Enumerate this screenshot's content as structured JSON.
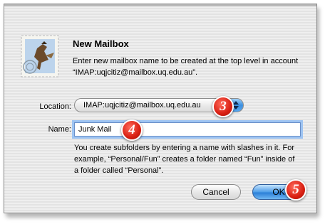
{
  "dialog": {
    "title": "New Mailbox",
    "message": "Enter new mailbox name to be created at the top level in account “IMAP:uqjcitiz@mailbox.uq.edu.au”.",
    "location_label": "Location:",
    "location_value": "IMAP:uqjcitiz@mailbox.uq.edu.au",
    "name_label": "Name:",
    "name_value": "Junk Mail",
    "help_text": "You create subfolders by entering a name with slashes in it. For example, “Personal/Fun” creates a folder named “Fun” inside of a folder called “Personal”.",
    "cancel_label": "Cancel",
    "ok_label": "OK"
  },
  "steps": {
    "three": "3",
    "four": "4",
    "five": "5"
  },
  "icons": {
    "app": "mail-stamp-icon",
    "popup": "up-down-arrows-icon"
  },
  "colors": {
    "accent": "#3b8fe0",
    "focus_ring": "#9ec4f2",
    "step_badge": "#d81f12"
  }
}
